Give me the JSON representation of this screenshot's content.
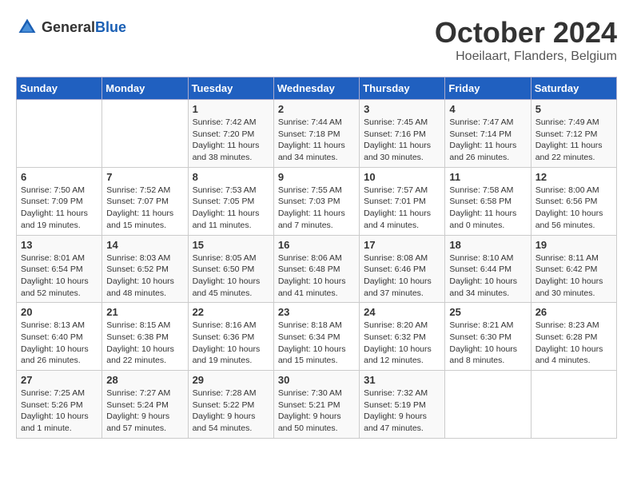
{
  "header": {
    "logo_general": "General",
    "logo_blue": "Blue",
    "month": "October 2024",
    "location": "Hoeilaart, Flanders, Belgium"
  },
  "days_of_week": [
    "Sunday",
    "Monday",
    "Tuesday",
    "Wednesday",
    "Thursday",
    "Friday",
    "Saturday"
  ],
  "weeks": [
    [
      {
        "day": "",
        "info": ""
      },
      {
        "day": "",
        "info": ""
      },
      {
        "day": "1",
        "info": "Sunrise: 7:42 AM\nSunset: 7:20 PM\nDaylight: 11 hours and 38 minutes."
      },
      {
        "day": "2",
        "info": "Sunrise: 7:44 AM\nSunset: 7:18 PM\nDaylight: 11 hours and 34 minutes."
      },
      {
        "day": "3",
        "info": "Sunrise: 7:45 AM\nSunset: 7:16 PM\nDaylight: 11 hours and 30 minutes."
      },
      {
        "day": "4",
        "info": "Sunrise: 7:47 AM\nSunset: 7:14 PM\nDaylight: 11 hours and 26 minutes."
      },
      {
        "day": "5",
        "info": "Sunrise: 7:49 AM\nSunset: 7:12 PM\nDaylight: 11 hours and 22 minutes."
      }
    ],
    [
      {
        "day": "6",
        "info": "Sunrise: 7:50 AM\nSunset: 7:09 PM\nDaylight: 11 hours and 19 minutes."
      },
      {
        "day": "7",
        "info": "Sunrise: 7:52 AM\nSunset: 7:07 PM\nDaylight: 11 hours and 15 minutes."
      },
      {
        "day": "8",
        "info": "Sunrise: 7:53 AM\nSunset: 7:05 PM\nDaylight: 11 hours and 11 minutes."
      },
      {
        "day": "9",
        "info": "Sunrise: 7:55 AM\nSunset: 7:03 PM\nDaylight: 11 hours and 7 minutes."
      },
      {
        "day": "10",
        "info": "Sunrise: 7:57 AM\nSunset: 7:01 PM\nDaylight: 11 hours and 4 minutes."
      },
      {
        "day": "11",
        "info": "Sunrise: 7:58 AM\nSunset: 6:58 PM\nDaylight: 11 hours and 0 minutes."
      },
      {
        "day": "12",
        "info": "Sunrise: 8:00 AM\nSunset: 6:56 PM\nDaylight: 10 hours and 56 minutes."
      }
    ],
    [
      {
        "day": "13",
        "info": "Sunrise: 8:01 AM\nSunset: 6:54 PM\nDaylight: 10 hours and 52 minutes."
      },
      {
        "day": "14",
        "info": "Sunrise: 8:03 AM\nSunset: 6:52 PM\nDaylight: 10 hours and 48 minutes."
      },
      {
        "day": "15",
        "info": "Sunrise: 8:05 AM\nSunset: 6:50 PM\nDaylight: 10 hours and 45 minutes."
      },
      {
        "day": "16",
        "info": "Sunrise: 8:06 AM\nSunset: 6:48 PM\nDaylight: 10 hours and 41 minutes."
      },
      {
        "day": "17",
        "info": "Sunrise: 8:08 AM\nSunset: 6:46 PM\nDaylight: 10 hours and 37 minutes."
      },
      {
        "day": "18",
        "info": "Sunrise: 8:10 AM\nSunset: 6:44 PM\nDaylight: 10 hours and 34 minutes."
      },
      {
        "day": "19",
        "info": "Sunrise: 8:11 AM\nSunset: 6:42 PM\nDaylight: 10 hours and 30 minutes."
      }
    ],
    [
      {
        "day": "20",
        "info": "Sunrise: 8:13 AM\nSunset: 6:40 PM\nDaylight: 10 hours and 26 minutes."
      },
      {
        "day": "21",
        "info": "Sunrise: 8:15 AM\nSunset: 6:38 PM\nDaylight: 10 hours and 22 minutes."
      },
      {
        "day": "22",
        "info": "Sunrise: 8:16 AM\nSunset: 6:36 PM\nDaylight: 10 hours and 19 minutes."
      },
      {
        "day": "23",
        "info": "Sunrise: 8:18 AM\nSunset: 6:34 PM\nDaylight: 10 hours and 15 minutes."
      },
      {
        "day": "24",
        "info": "Sunrise: 8:20 AM\nSunset: 6:32 PM\nDaylight: 10 hours and 12 minutes."
      },
      {
        "day": "25",
        "info": "Sunrise: 8:21 AM\nSunset: 6:30 PM\nDaylight: 10 hours and 8 minutes."
      },
      {
        "day": "26",
        "info": "Sunrise: 8:23 AM\nSunset: 6:28 PM\nDaylight: 10 hours and 4 minutes."
      }
    ],
    [
      {
        "day": "27",
        "info": "Sunrise: 7:25 AM\nSunset: 5:26 PM\nDaylight: 10 hours and 1 minute."
      },
      {
        "day": "28",
        "info": "Sunrise: 7:27 AM\nSunset: 5:24 PM\nDaylight: 9 hours and 57 minutes."
      },
      {
        "day": "29",
        "info": "Sunrise: 7:28 AM\nSunset: 5:22 PM\nDaylight: 9 hours and 54 minutes."
      },
      {
        "day": "30",
        "info": "Sunrise: 7:30 AM\nSunset: 5:21 PM\nDaylight: 9 hours and 50 minutes."
      },
      {
        "day": "31",
        "info": "Sunrise: 7:32 AM\nSunset: 5:19 PM\nDaylight: 9 hours and 47 minutes."
      },
      {
        "day": "",
        "info": ""
      },
      {
        "day": "",
        "info": ""
      }
    ]
  ]
}
